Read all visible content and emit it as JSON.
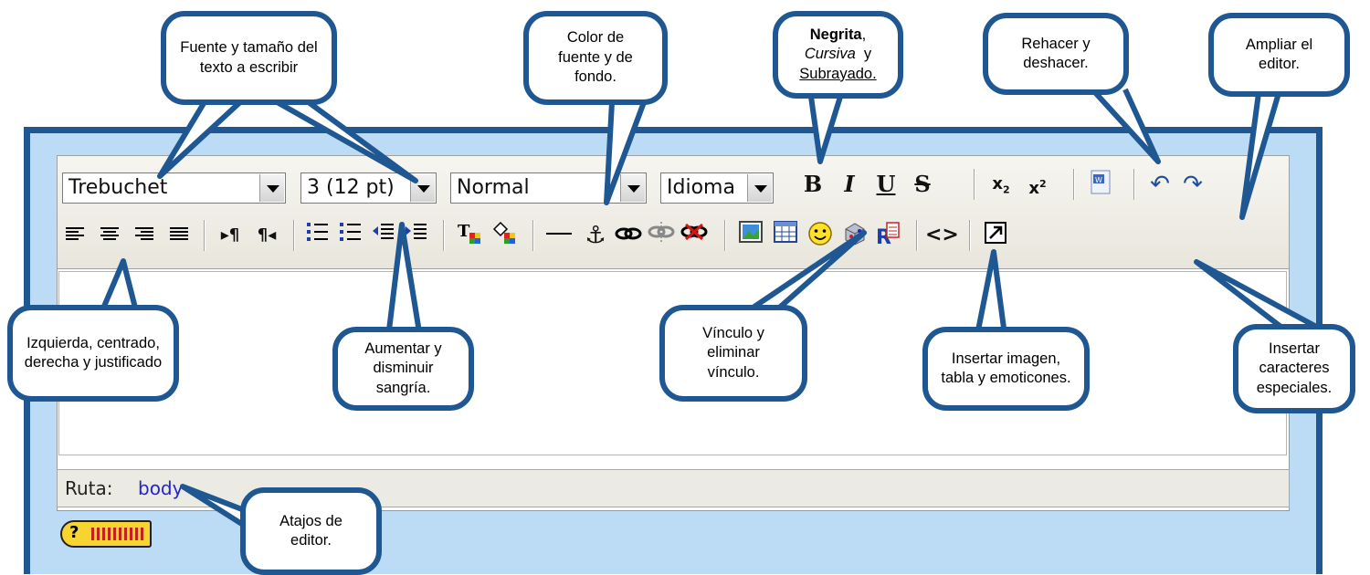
{
  "toolbar": {
    "font_family": "Trebuchet",
    "font_size": "3 (12 pt)",
    "format": "Normal",
    "language": "Idioma",
    "buttons_row1": [
      {
        "name": "bold-button",
        "glyph": "B"
      },
      {
        "name": "italic-button",
        "glyph": "I"
      },
      {
        "name": "underline-button",
        "glyph": "U"
      },
      {
        "name": "strikethrough-button",
        "glyph": "S"
      },
      {
        "name": "subscript-button",
        "glyph": "x₂"
      },
      {
        "name": "superscript-button",
        "glyph": "x²"
      },
      {
        "name": "paste-word-button",
        "glyph": "W"
      },
      {
        "name": "undo-button",
        "glyph": "↶"
      },
      {
        "name": "redo-button",
        "glyph": "↷"
      }
    ],
    "buttons_row2": [
      {
        "name": "align-left-button",
        "glyph": "≡"
      },
      {
        "name": "align-center-button",
        "glyph": "≡"
      },
      {
        "name": "align-right-button",
        "glyph": "≡"
      },
      {
        "name": "justify-button",
        "glyph": "≣"
      },
      {
        "name": "ltr-button",
        "glyph": "▸¶"
      },
      {
        "name": "rtl-button",
        "glyph": "¶◂"
      },
      {
        "name": "ordered-list-button",
        "glyph": "⋮≡"
      },
      {
        "name": "unordered-list-button",
        "glyph": "•≡"
      },
      {
        "name": "outdent-button",
        "glyph": "⇤"
      },
      {
        "name": "indent-button",
        "glyph": "⇥"
      },
      {
        "name": "font-color-button",
        "glyph": "T"
      },
      {
        "name": "background-color-button",
        "glyph": "◈"
      },
      {
        "name": "horizontal-rule-button",
        "glyph": "—"
      },
      {
        "name": "anchor-button",
        "glyph": "⚓"
      },
      {
        "name": "link-button",
        "glyph": "∞"
      },
      {
        "name": "unlink-button",
        "glyph": "∞"
      },
      {
        "name": "nolink-button",
        "glyph": "✕"
      },
      {
        "name": "insert-image-button",
        "glyph": "▣"
      },
      {
        "name": "insert-table-button",
        "glyph": "▦"
      },
      {
        "name": "emoticon-button",
        "glyph": "☺"
      },
      {
        "name": "special-chars-button",
        "glyph": "◎"
      },
      {
        "name": "find-replace-button",
        "glyph": "R"
      },
      {
        "name": "html-source-button",
        "glyph": "<>"
      },
      {
        "name": "fullscreen-button",
        "glyph": "⇗"
      }
    ]
  },
  "pathbar": {
    "label": "Ruta:",
    "value": "body"
  },
  "callouts": {
    "font": "Fuente y tamaño del texto a escribir",
    "color": "Color de fuente y de fondo.",
    "style_bold": "Negrita",
    "style_comma": ",",
    "style_italic": "Cursiva",
    "style_and": "y",
    "style_underline": "Subrayado.",
    "undo": "Rehacer y deshacer.",
    "fullscreen": "Ampliar el editor.",
    "align": "Izquierda, centrado, derecha y justificado",
    "indent": "Aumentar y disminuir sangría.",
    "link": "Vínculo y eliminar vínculo.",
    "insert": "Insertar imagen, tabla y emoticones.",
    "chars": "Insertar caracteres especiales.",
    "shortcuts": "Atajos de editor."
  },
  "colors": {
    "frame_border": "#1e5791",
    "frame_fill": "#bcdcf6",
    "path_link": "#2323d6"
  }
}
